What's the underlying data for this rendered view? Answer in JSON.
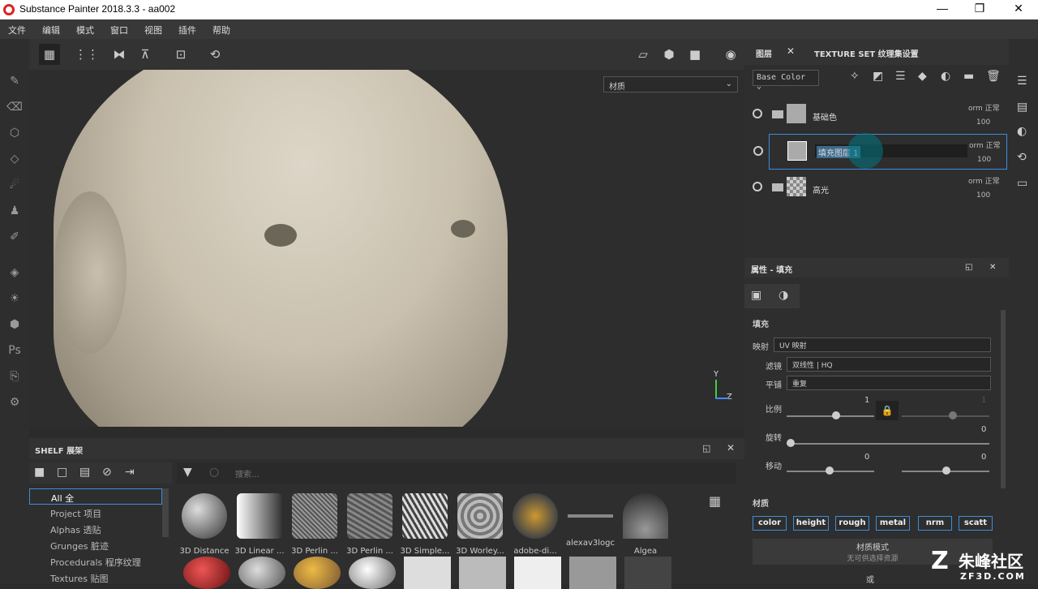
{
  "window": {
    "title": "Substance Painter 2018.3.3 - aa002",
    "minimize": "—",
    "maximize": "❐",
    "close": "✕"
  },
  "menu": [
    "文件",
    "编辑",
    "模式",
    "窗口",
    "视图",
    "插件",
    "帮助"
  ],
  "viewport": {
    "material_select": "材质",
    "axis_y": "Y",
    "axis_z": "Z"
  },
  "shelf": {
    "title": "SHELF 展架",
    "search_placeholder": "搜索...",
    "categories": [
      "All 全",
      "Project 项目",
      "Alphas 透贴",
      "Grunges 脏迹",
      "Procedurals 程序纹理",
      "Textures 贴图"
    ],
    "items": [
      "3D Distance",
      "3D Linear ...",
      "3D Perlin ...",
      "3D Perlin ...",
      "3D Simple...",
      "3D Worley...",
      "adobe-di...",
      "alexav3logc",
      "Algea"
    ]
  },
  "layers": {
    "tab_layers": "图层",
    "tab_texture_set": "TEXTURE SET 纹理集设置",
    "channel": "Base Color",
    "rows": [
      {
        "name": "基础色",
        "blend": "orm 正常",
        "opacity": "100"
      },
      {
        "name": "填充图层 1",
        "blend": "orm 正常",
        "opacity": "100"
      },
      {
        "name": "高光",
        "blend": "orm 正常",
        "opacity": "100"
      }
    ]
  },
  "properties": {
    "title": "属性 - 填充",
    "section": "填充",
    "projection_label": "映射",
    "projection_value": "UV 映射",
    "filter_label": "滤镜",
    "filter_value": "双线性 | HQ",
    "tiling_label": "平铺",
    "tiling_value": "重复",
    "scale_label": "比例",
    "scale_value": "1",
    "scale_value2": "1",
    "rotation_label": "旋转",
    "rotation_value": "0",
    "offset_label": "移动",
    "offset_x": "0",
    "offset_y": "0",
    "material_label": "材质",
    "channels": [
      "color",
      "height",
      "rough",
      "metal",
      "nrm",
      "scatt"
    ],
    "material_mode": "材质模式",
    "material_mode_sub": "无可供选择资源",
    "or": "或"
  },
  "watermark": {
    "text": "朱峰社区",
    "url": "ZF3D.COM"
  }
}
